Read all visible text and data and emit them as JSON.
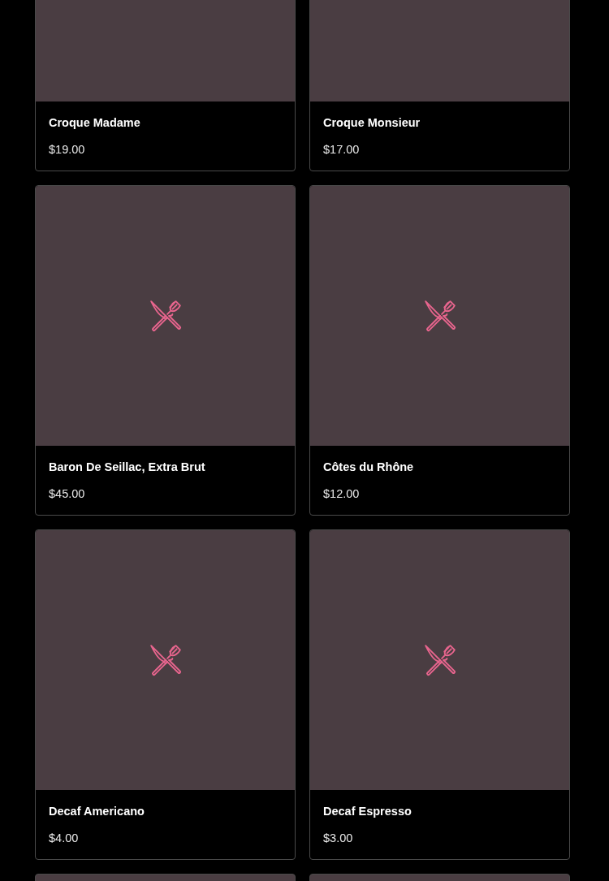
{
  "menu_items": [
    {
      "kind": "clipped",
      "name": "Croque Madame",
      "price": "$19.00"
    },
    {
      "kind": "clipped",
      "name": "Croque Monsieur",
      "price": "$17.00"
    },
    {
      "kind": "dish",
      "name": "Baron De Seillac, Extra Brut",
      "price": "$45.00"
    },
    {
      "kind": "dish",
      "name": "Côtes du Rhône",
      "price": "$12.00"
    },
    {
      "kind": "dish",
      "name": "Decaf Americano",
      "price": "$4.00"
    },
    {
      "kind": "dish",
      "name": "Decaf Espresso",
      "price": "$3.00"
    },
    {
      "kind": "partial"
    },
    {
      "kind": "partial"
    }
  ]
}
